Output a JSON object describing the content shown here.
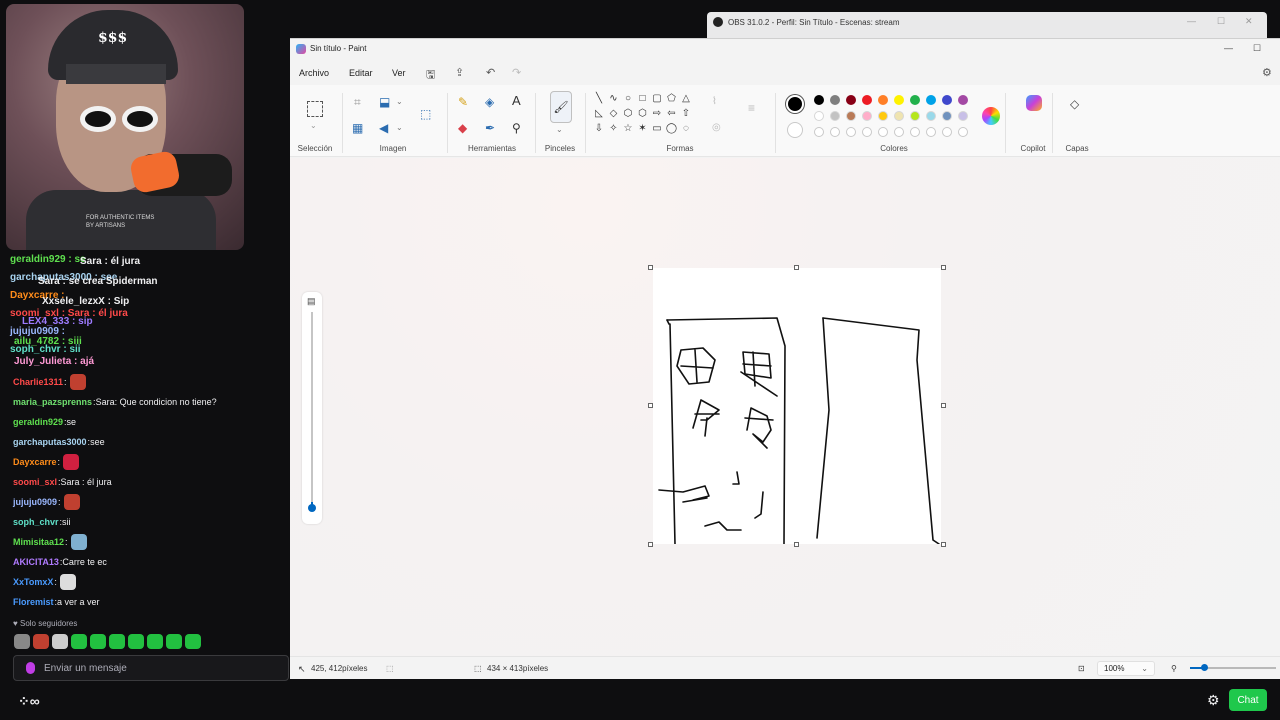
{
  "obs": {
    "title": "OBS 31.0.2 - Perfil: Sin Título - Escenas: stream"
  },
  "paint": {
    "title": "Sin título - Paint",
    "menu": [
      "Archivo",
      "Editar",
      "Ver"
    ],
    "groups": {
      "selection": "Selección",
      "image": "Imagen",
      "tools": "Herramientas",
      "brushes": "Pinceles",
      "shapes": "Formas",
      "colors": "Colores",
      "copilot": "Copilot",
      "layers": "Capas"
    },
    "status": {
      "cursor_pos": "425, 412píxeles",
      "canvas_size": "434 × 413píxeles",
      "zoom": "100%"
    },
    "palette_row1": [
      "#000000",
      "#7f7f7f",
      "#880015",
      "#ed1c24",
      "#ff7f27",
      "#fff200",
      "#22b14c",
      "#00a2e8",
      "#3f48cc",
      "#a349a4"
    ],
    "palette_row2": [
      "#ffffff",
      "#c3c3c3",
      "#b97a57",
      "#ffaec9",
      "#ffc90e",
      "#efe4b0",
      "#b5e61d",
      "#99d9ea",
      "#7092be",
      "#c8bfe7"
    ],
    "accent": "#0067c0",
    "zoom_slider_fraction": 0.05
  },
  "chat": {
    "overlap": [
      {
        "text": "geraldin929 : se",
        "color": "#5fe04f"
      },
      {
        "text": "Sara : él jura",
        "color": "#efeff1"
      },
      {
        "text": "garchaputas3000 : see",
        "color": "#a8d3f0"
      },
      {
        "text": "Sara : se crea Spiderman",
        "color": "#efeff1"
      },
      {
        "text": "Dayxcarre :",
        "color": "#ff8c1a"
      },
      {
        "text": "Xxsele_lezxX : Sip",
        "color": "#efeff1"
      },
      {
        "text": "soomi_sxl : Sara : él jura",
        "color": "#ff4a4a"
      },
      {
        "text": "LEX4_333 : sip",
        "color": "#9d7bff"
      },
      {
        "text": "jujuju0909 :",
        "color": "#9bb8ff"
      },
      {
        "text": "ailu_4782 : siii",
        "color": "#5fe04f"
      },
      {
        "text": "soph_chvr : sii",
        "color": "#5fe0c8"
      },
      {
        "text": "July_Julieta : ajá",
        "color": "#ff9ad5"
      }
    ],
    "messages": [
      {
        "user": "Charlie1311",
        "color": "#ff4a4a",
        "text": "",
        "emote": "#c04030"
      },
      {
        "user": "maria_pazsprenns",
        "color": "#6fe06f",
        "text": "Sara: Que condicion no tiene?",
        "emote": ""
      },
      {
        "user": "geraldin929",
        "color": "#5fe04f",
        "text": "se",
        "emote": ""
      },
      {
        "user": "garchaputas3000",
        "color": "#a8d3f0",
        "text": "see",
        "emote": ""
      },
      {
        "user": "Dayxcarre",
        "color": "#ff8c1a",
        "text": "",
        "emote": "#d02040"
      },
      {
        "user": "soomi_sxl",
        "color": "#ff4a4a",
        "text": "Sara : él jura",
        "emote": ""
      },
      {
        "user": "jujuju0909",
        "color": "#9bb8ff",
        "text": "",
        "emote": "#c04030"
      },
      {
        "user": "soph_chvr",
        "color": "#5fe0c8",
        "text": "sii",
        "emote": ""
      },
      {
        "user": "Mimisitaa12",
        "color": "#5fe04f",
        "text": "",
        "emote": "#7fb0d0"
      },
      {
        "user": "AKICITA13",
        "color": "#b07bff",
        "text": "Carre te ec",
        "emote": ""
      },
      {
        "user": "XxTomxX",
        "color": "#4a9bff",
        "text": "",
        "emote": "#dddddd"
      },
      {
        "user": "Floremist",
        "color": "#4a9bff",
        "text": "a ver a ver",
        "emote": ""
      }
    ],
    "followers_only": "Solo seguidores",
    "input_placeholder": "Enviar un mensaje",
    "chat_button": "Chat",
    "emote_colors": [
      "#888",
      "#c04030",
      "#ccc",
      "#22c040",
      "#22c040",
      "#22c040",
      "#22c040",
      "#22c040",
      "#22c040",
      "#22c040"
    ]
  },
  "webcam": {
    "cap_text": "$$$",
    "shirt_text": "FOR AUTHENTIC ITEMS BY ARTISANS"
  }
}
